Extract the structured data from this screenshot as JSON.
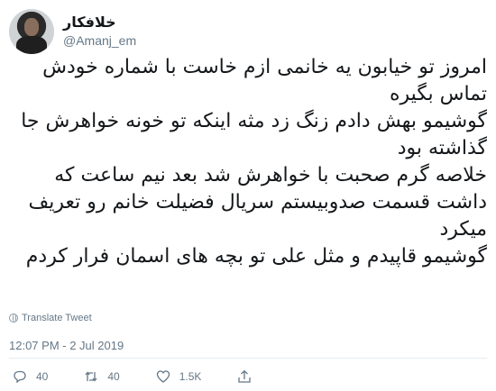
{
  "user": {
    "display_name": "خلافکار",
    "handle": "@Amanj_em"
  },
  "tweet": {
    "lines": [
      "امروز تو خیابون یه خانمی ازم خاست با شماره خودش تماس بگیره",
      "گوشیمو بهش دادم زنگ زد مثه اینکه تو خونه خواهرش جا گذاشته بود",
      "خلاصه گرم صحبت با خواهرش شد بعد نیم ساعت که داشت قسمت صدوبیستم سریال فضیلت خانم رو تعریف میکرد",
      "گوشیمو قاپیدم و مثل علی تو بچه های اسمان فرار کردم"
    ],
    "translate_label": "Translate Tweet",
    "timestamp": "12:07 PM - 2 Jul 2019"
  },
  "actions": {
    "reply_count": "40",
    "retweet_count": "40",
    "like_count": "1.5K"
  },
  "icons": {
    "reply": "reply-icon",
    "retweet": "retweet-icon",
    "like": "heart-icon",
    "share": "share-icon",
    "translate": "globe-icon"
  },
  "colors": {
    "text": "#14171a",
    "muted": "#657786",
    "divider": "#e6ecf0"
  }
}
